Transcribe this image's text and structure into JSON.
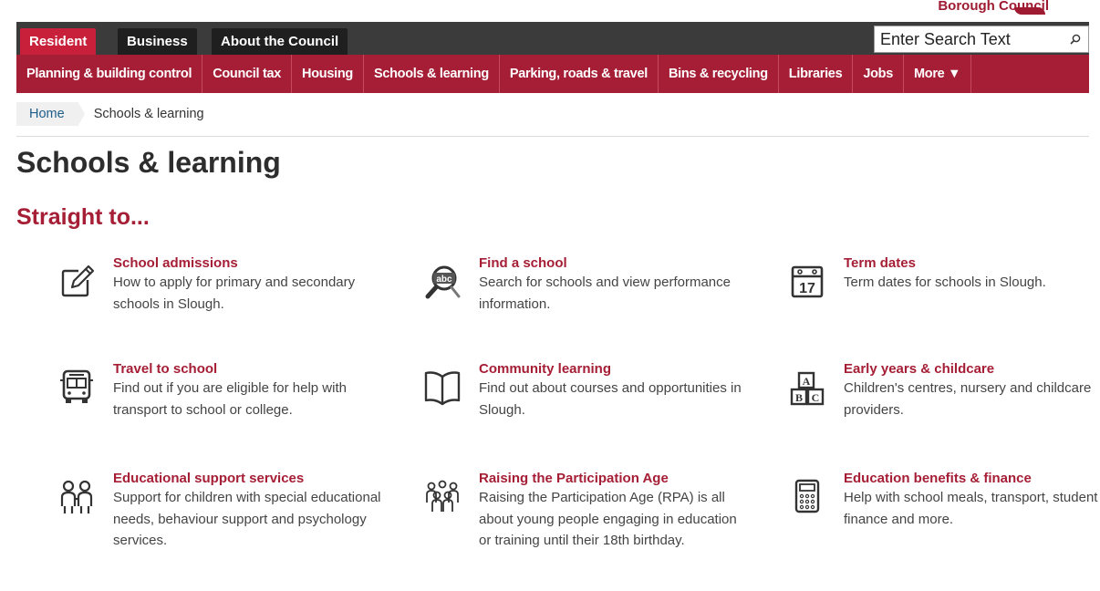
{
  "header": {
    "council_name": "Borough Council"
  },
  "top_tabs": [
    {
      "label": "Resident"
    },
    {
      "label": "Business"
    },
    {
      "label": "About the Council"
    }
  ],
  "search": {
    "placeholder": "Enter Search Text"
  },
  "subnav": [
    {
      "label": "Planning & building control"
    },
    {
      "label": "Council tax"
    },
    {
      "label": "Housing"
    },
    {
      "label": "Schools & learning"
    },
    {
      "label": "Parking, roads & travel"
    },
    {
      "label": "Bins & recycling"
    },
    {
      "label": "Libraries"
    },
    {
      "label": "Jobs"
    },
    {
      "label": "More ▼"
    }
  ],
  "breadcrumb": {
    "home": "Home",
    "current": "Schools & learning"
  },
  "page_title": "Schools & learning",
  "section_title": "Straight to...",
  "items": [
    {
      "title": "School admissions",
      "desc": "How to apply for primary and secondary schools in Slough.",
      "icon": "pencil-edit-icon"
    },
    {
      "title": "Find a school",
      "desc": "Search for schools and view performance information.",
      "icon": "magnifier-abc-icon"
    },
    {
      "title": "Term dates",
      "desc": "Term dates for schools in Slough.",
      "icon": "calendar-icon",
      "calendar_day": "17"
    },
    {
      "title": "Travel to school",
      "desc": "Find out if you are eligible for help with transport to school or college.",
      "icon": "bus-icon"
    },
    {
      "title": "Community learning",
      "desc": "Find out about courses and opportunities in Slough.",
      "icon": "open-book-icon"
    },
    {
      "title": "Early years & childcare",
      "desc": "Children's centres, nursery and childcare providers.",
      "icon": "abc-blocks-icon",
      "block_letters": [
        "A",
        "B",
        "C"
      ]
    },
    {
      "title": "Educational support services",
      "desc": "Support for children with special educational needs, behaviour support and psychology services.",
      "icon": "people-pair-icon"
    },
    {
      "title": "Raising the Participation Age",
      "desc": "Raising the Participation Age (RPA) is all about young people engaging in education or training until their 18th birthday.",
      "icon": "people-group-icon"
    },
    {
      "title": "Education benefits & finance",
      "desc": "Help with school meals, transport, student finance and more.",
      "icon": "calculator-icon"
    }
  ],
  "colors": {
    "brand_red": "#a51e35",
    "active_tab": "#c8203a",
    "dark_nav": "#3b3b3b"
  }
}
